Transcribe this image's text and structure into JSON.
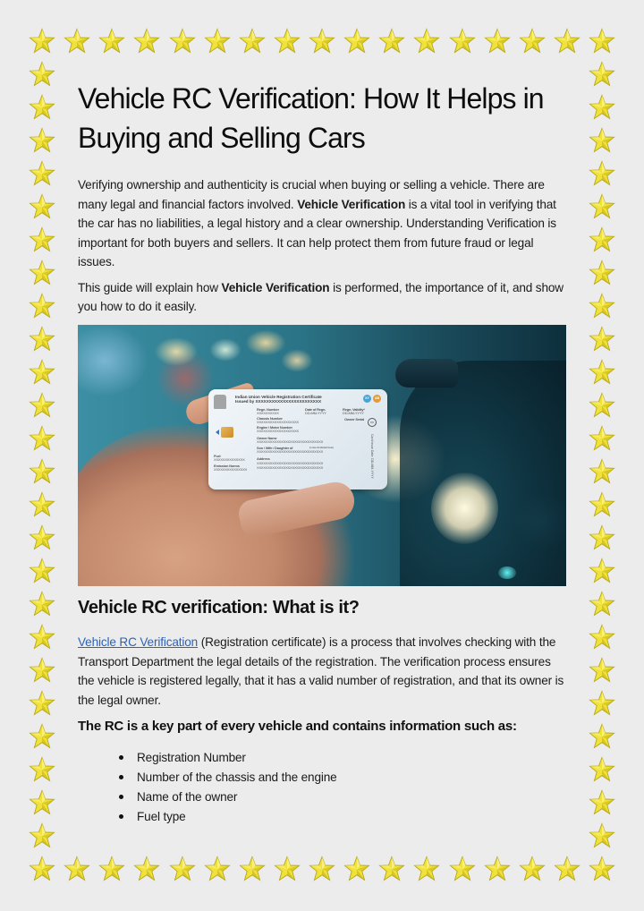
{
  "document": {
    "title": "Vehicle RC Verification: How It Helps in Buying and Selling Cars",
    "title_line1": "Vehicle RC Verification: How It Helps in",
    "title_line2": "Buying and Selling Cars",
    "intro": {
      "part1": "Verifying ownership and authenticity is crucial when buying or selling a vehicle. There are many legal and financial factors involved. ",
      "bold": "Vehicle Verification",
      "part2": " is a vital tool in verifying that the car has no liabilities, a legal history and a clear ownership. Understanding Verification is important for both buyers and sellers. It can help protect them from future fraud or legal issues."
    },
    "guide": {
      "part1": "This guide will explain how ",
      "bold": "Vehicle Verification",
      "part2": " is performed, the importance of it, and show you how to do it easily."
    },
    "image": {
      "alt": "Hand holding an Indian Union Vehicle Registration Certificate card in front of a car",
      "card": {
        "heading1": "Indian Union Vehicle Registration Certificate",
        "heading2": "Issued by XXXXXXXXXXXXXXXXXXXXXXXX",
        "badge1": "XY",
        "badge2": "AB",
        "regn_number_label": "Regn. Number",
        "regn_number_value": "XXXXXXXXXX",
        "date_of_regn_label": "Date of Regn.",
        "date_of_regn_value": "DD-MM-YYYY",
        "regn_validity_label": "Regn. Validity*",
        "regn_validity_value": "DD-MM-YYYY",
        "chassis_label": "Chassis Number",
        "chassis_value": "XXXXXXXXXXXXXXXXXXX",
        "owner_serial_label": "Owner Serial",
        "owner_serial_value": "XX",
        "engine_label": "Engine / Motor Number",
        "engine_value": "XXXXXXXXXXXXXXXXXXX",
        "owner_name_label": "Owner Name",
        "owner_name_value": "XXXXXXXXXXXXXXXXXXXXXXXXXXXXXX",
        "relation_label": "Son / Wife / Daughter of",
        "relation_note": "(in case of individual Owner)",
        "relation_value": "XXXXXXXXXXXXXXXXXXXXXXXXXXXXXX",
        "fuel_label": "Fuel",
        "fuel_value": "XXXXXXXXXXXXXX",
        "emission_label": "Emission Norms",
        "emission_value": "XXXXXXXXXXXXXXX",
        "address_label": "Address",
        "address_line1": "XXXXXXXXXXXXXXXXXXXXXXXXXXXXXX",
        "address_line2": "XXXXXXXXXXXXXXXXXXXXXXXXXXXXXX",
        "card_issue_date": "Card Issue Date: DD-MM-YYYY"
      }
    },
    "section_heading": "Vehicle RC verification: What is it?",
    "section_para": {
      "link_text": "Vehicle RC Verification",
      "text": " (Registration certificate) is a process that involves checking with the Transport Department the legal details of the registration. The verification process ensures the vehicle is registered legally, that it has a valid number of registration, and that its owner is the legal owner."
    },
    "subheading": "The RC is a key part of every vehicle and contains information such as:",
    "list_items": [
      "Registration Number",
      "Number of the chassis and the engine",
      "Name of the owner",
      "Fuel type"
    ]
  },
  "border": {
    "icon": "star-icon",
    "color": "#f0e23a",
    "stroke_color": "#b5a81a",
    "stars_per_row": 17,
    "stars_per_column": 26
  },
  "colors": {
    "page_background": "#ececec",
    "link": "#2a63b8",
    "text": "#111111"
  }
}
